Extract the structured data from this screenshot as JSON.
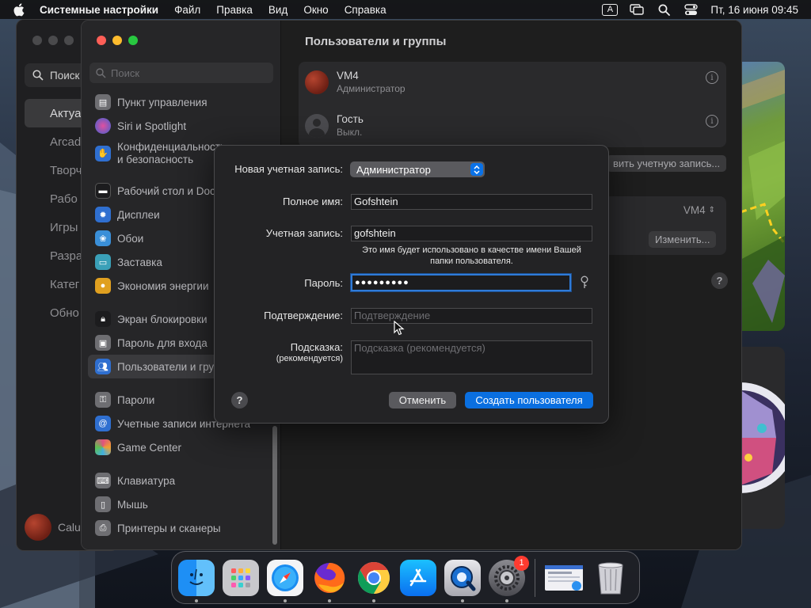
{
  "menubar": {
    "app_name": "Системные настройки",
    "menus": [
      "Файл",
      "Правка",
      "Вид",
      "Окно",
      "Справка"
    ],
    "input_source": "A",
    "clock": "Пт, 16 июня  09:45"
  },
  "background_window": {
    "search_placeholder": "Поиск",
    "items": [
      "Актуа",
      "Arcad",
      "Творч",
      "Рабо",
      "Игры",
      "Разра",
      "Катег",
      "Обно"
    ],
    "user": "Calu"
  },
  "sidebar": {
    "search_placeholder": "Поиск",
    "items": [
      {
        "label": "Пункт управления",
        "icon": "control-center-icon",
        "color": "#6e6e72"
      },
      {
        "label": "Siri и Spotlight",
        "icon": "siri-icon",
        "color": "#b5489a"
      },
      {
        "label": "Конфиденциальность и безопасность",
        "icon": "hand-icon",
        "color": "#2f6fd0"
      },
      {
        "label": "Рабочий стол и Dock",
        "icon": "desktop-dock-icon",
        "color": "#1c1c1e"
      },
      {
        "label": "Дисплеи",
        "icon": "sun-icon",
        "color": "#2f6fd0"
      },
      {
        "label": "Обои",
        "icon": "wallpaper-icon",
        "color": "#3a8fd8"
      },
      {
        "label": "Заставка",
        "icon": "screensaver-icon",
        "color": "#3aa0b8"
      },
      {
        "label": "Экономия энергии",
        "icon": "bulb-icon",
        "color": "#e0a020"
      },
      {
        "label": "Экран блокировки",
        "icon": "lock-icon",
        "color": "#1c1c1e"
      },
      {
        "label": "Пароль для входа",
        "icon": "password-icon",
        "color": "#6e6e72"
      },
      {
        "label": "Пользователи и группы",
        "icon": "users-icon",
        "color": "#2f6fd0"
      },
      {
        "label": "Пароли",
        "icon": "key-icon",
        "color": "#6e6e72"
      },
      {
        "label": "Учетные записи интернета",
        "icon": "at-icon",
        "color": "#2f6fd0"
      },
      {
        "label": "Game Center",
        "icon": "game-center-icon",
        "color": "#e05080"
      },
      {
        "label": "Клавиатура",
        "icon": "keyboard-icon",
        "color": "#6e6e72"
      },
      {
        "label": "Мышь",
        "icon": "mouse-icon",
        "color": "#6e6e72"
      },
      {
        "label": "Принтеры и сканеры",
        "icon": "printer-icon",
        "color": "#6e6e72"
      }
    ]
  },
  "content": {
    "title": "Пользователи и группы",
    "users": [
      {
        "name": "VM4",
        "role": "Администратор"
      },
      {
        "name": "Гость",
        "role": "Выкл."
      }
    ],
    "add_account_button": "вить учетную запись...",
    "auto_login_value": "VM4",
    "change_button": "Изменить...",
    "help": "?"
  },
  "dialog": {
    "new_account_label": "Новая учетная запись:",
    "new_account_value": "Администратор",
    "full_name_label": "Полное имя:",
    "full_name_value": "Gofshtein",
    "account_label": "Учетная запись:",
    "account_value": "gofshtein",
    "account_note": "Это имя будет использовано в качестве имени Вашей папки пользователя.",
    "password_label": "Пароль:",
    "password_value": "●●●●●●●●●",
    "confirm_label": "Подтверждение:",
    "confirm_placeholder": "Подтверждение",
    "hint_label": "Подсказка:",
    "hint_sublabel": "(рекомендуется)",
    "hint_placeholder": "Подсказка (рекомендуется)",
    "help": "?",
    "cancel_button": "Отменить",
    "create_button": "Создать пользователя"
  },
  "dock": {
    "apps": [
      "finder-icon",
      "launchpad-icon",
      "safari-icon",
      "firefox-icon",
      "chrome-icon",
      "app-store-icon",
      "quicktime-icon",
      "system-settings-icon",
      "preview-window-icon",
      "trash-icon"
    ],
    "settings_badge": "1"
  }
}
